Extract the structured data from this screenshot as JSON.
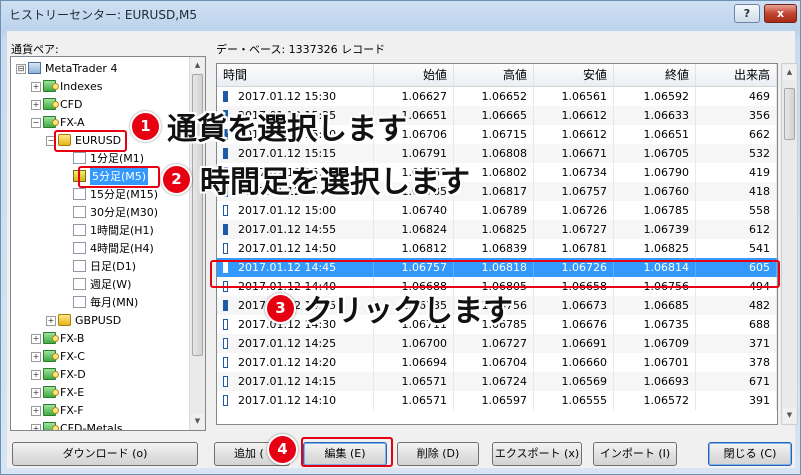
{
  "window": {
    "title": "ヒストリーセンター: EURUSD,M5",
    "help_label": "?",
    "close_label": "x"
  },
  "left_panel": {
    "label": "通貨ペア:"
  },
  "tree": [
    {
      "label": "MetaTrader 4",
      "expander": "⊟",
      "icon": "terminal-icon"
    },
    {
      "label": "Indexes",
      "expander": "+",
      "icon": "folder-icon"
    },
    {
      "label": "CFD",
      "expander": "+",
      "icon": "folder-icon"
    },
    {
      "label": "FX-A",
      "expander": "−",
      "icon": "folder-icon"
    },
    {
      "label": "EURUSD",
      "expander": "−",
      "icon": "symbol-icon"
    },
    {
      "label": "1分足(M1)",
      "icon": "timeframe-icon"
    },
    {
      "label": "5分足(M5)",
      "icon": "timeframe-selected-icon"
    },
    {
      "label": "15分足(M15)",
      "icon": "timeframe-icon"
    },
    {
      "label": "30分足(M30)",
      "icon": "timeframe-icon"
    },
    {
      "label": "1時間足(H1)",
      "icon": "timeframe-icon"
    },
    {
      "label": "4時間足(H4)",
      "icon": "timeframe-icon"
    },
    {
      "label": "日足(D1)",
      "icon": "timeframe-icon"
    },
    {
      "label": "週足(W)",
      "icon": "timeframe-icon"
    },
    {
      "label": "毎月(MN)",
      "icon": "timeframe-icon"
    },
    {
      "label": "GBPUSD",
      "expander": "+",
      "icon": "symbol-icon"
    },
    {
      "label": "FX-B",
      "expander": "+",
      "icon": "folder-icon"
    },
    {
      "label": "FX-C",
      "expander": "+",
      "icon": "folder-icon"
    },
    {
      "label": "FX-D",
      "expander": "+",
      "icon": "folder-icon"
    },
    {
      "label": "FX-E",
      "expander": "+",
      "icon": "folder-icon"
    },
    {
      "label": "FX-F",
      "expander": "+",
      "icon": "folder-icon"
    },
    {
      "label": "CFD-Metals",
      "expander": "+",
      "icon": "folder-icon"
    }
  ],
  "database": {
    "label": "デー・ベース: 1337326 レコード"
  },
  "table": {
    "columns": [
      "時間",
      "始値",
      "高値",
      "安値",
      "終値",
      "出来高"
    ],
    "rows": [
      {
        "time": "2017.01.12 15:30",
        "open": "1.06627",
        "high": "1.06652",
        "low": "1.06561",
        "close": "1.06592",
        "volume": "469",
        "candle": "down"
      },
      {
        "time": "2017.01.12 15:25",
        "open": "1.06651",
        "high": "1.06665",
        "low": "1.06612",
        "close": "1.06633",
        "volume": "356",
        "candle": "down"
      },
      {
        "time": "2017.01.12 15:20",
        "open": "1.06706",
        "high": "1.06715",
        "low": "1.06612",
        "close": "1.06651",
        "volume": "662",
        "candle": "down"
      },
      {
        "time": "2017.01.12 15:15",
        "open": "1.06791",
        "high": "1.06808",
        "low": "1.06671",
        "close": "1.06705",
        "volume": "532",
        "candle": "down"
      },
      {
        "time": "2017.01.12 15:10",
        "open": "1.06760",
        "high": "1.06802",
        "low": "1.06734",
        "close": "1.06790",
        "volume": "419",
        "candle": "up"
      },
      {
        "time": "2017.01.12 15:05",
        "open": "1.06785",
        "high": "1.06817",
        "low": "1.06757",
        "close": "1.06760",
        "volume": "418",
        "candle": "down"
      },
      {
        "time": "2017.01.12 15:00",
        "open": "1.06740",
        "high": "1.06789",
        "low": "1.06726",
        "close": "1.06785",
        "volume": "558",
        "candle": "up"
      },
      {
        "time": "2017.01.12 14:55",
        "open": "1.06824",
        "high": "1.06825",
        "low": "1.06727",
        "close": "1.06739",
        "volume": "612",
        "candle": "down"
      },
      {
        "time": "2017.01.12 14:50",
        "open": "1.06812",
        "high": "1.06839",
        "low": "1.06781",
        "close": "1.06825",
        "volume": "541",
        "candle": "up"
      },
      {
        "time": "2017.01.12 14:45",
        "open": "1.06757",
        "high": "1.06818",
        "low": "1.06726",
        "close": "1.06814",
        "volume": "605",
        "candle": "up"
      },
      {
        "time": "2017.01.12 14:40",
        "open": "1.06688",
        "high": "1.06805",
        "low": "1.06658",
        "close": "1.06756",
        "volume": "494",
        "candle": "up"
      },
      {
        "time": "2017.01.12 14:35",
        "open": "1.06735",
        "high": "1.06756",
        "low": "1.06673",
        "close": "1.06685",
        "volume": "482",
        "candle": "down"
      },
      {
        "time": "2017.01.12 14:30",
        "open": "1.06711",
        "high": "1.06785",
        "low": "1.06676",
        "close": "1.06735",
        "volume": "688",
        "candle": "up"
      },
      {
        "time": "2017.01.12 14:25",
        "open": "1.06700",
        "high": "1.06727",
        "low": "1.06691",
        "close": "1.06709",
        "volume": "371",
        "candle": "up"
      },
      {
        "time": "2017.01.12 14:20",
        "open": "1.06694",
        "high": "1.06704",
        "low": "1.06660",
        "close": "1.06701",
        "volume": "378",
        "candle": "up"
      },
      {
        "time": "2017.01.12 14:15",
        "open": "1.06571",
        "high": "1.06724",
        "low": "1.06569",
        "close": "1.06693",
        "volume": "671",
        "candle": "up"
      },
      {
        "time": "2017.01.12 14:10",
        "open": "1.06571",
        "high": "1.06597",
        "low": "1.06555",
        "close": "1.06572",
        "volume": "391",
        "candle": "up"
      }
    ],
    "selected_index": 9
  },
  "buttons": {
    "download": "ダウンロード (o)",
    "add": "追加 (",
    "edit": "編集 (E)",
    "delete": "削除 (D)",
    "export": "エクスポート (x)",
    "import": "インポート (I)",
    "close": "閉じる (C)"
  },
  "annotations": [
    {
      "number": "1",
      "text": "通貨を選択します"
    },
    {
      "number": "2",
      "text": "時間足を選択します"
    },
    {
      "number": "3",
      "text": "クリックします"
    },
    {
      "number": "4",
      "text": ""
    }
  ],
  "colors": {
    "selection": "#3399ff",
    "annotation_red": "#e60012",
    "candle_blue": "#1d5aa8"
  }
}
